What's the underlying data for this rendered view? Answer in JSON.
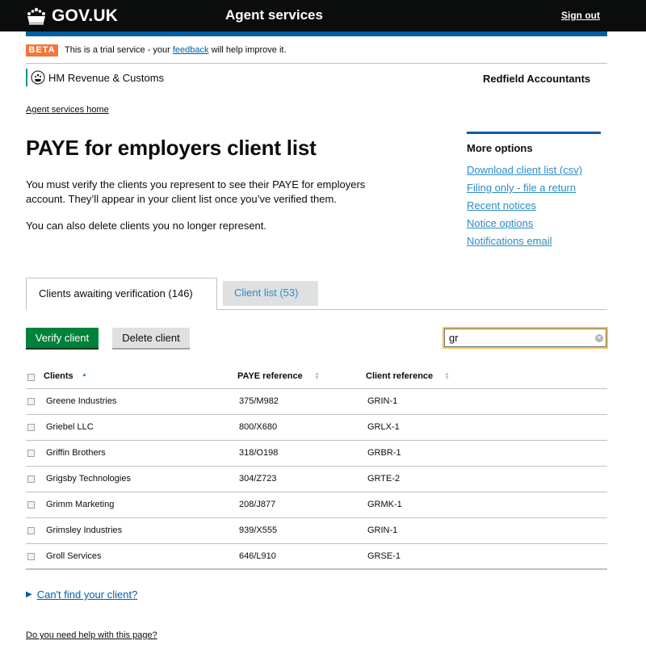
{
  "header": {
    "logo_text": "GOV.UK",
    "service_name": "Agent services",
    "sign_out": "Sign out"
  },
  "beta": {
    "tag": "BETA",
    "text_before": "This is a trial service - your ",
    "link": "feedback",
    "text_after": " will help improve it."
  },
  "department": "HM Revenue & Customs",
  "agent_name": "Redfield Accountants",
  "breadcrumb": "Agent services home",
  "page_title": "PAYE for employers client list",
  "intro": "You must verify the clients you represent to see their PAYE for employers account. They’ll appear in your client list once you’ve verified them.",
  "intro2": "You can also delete clients you no longer represent.",
  "sidebar": {
    "title": "More options",
    "links": [
      "Download client list (csv)",
      "Filing only - file a return",
      "Recent notices",
      "Notice options",
      "Notifications email"
    ]
  },
  "tabs": [
    {
      "label": "Clients awaiting verification (146)",
      "active": true
    },
    {
      "label": "Client list (53)",
      "active": false
    }
  ],
  "buttons": {
    "verify": "Verify client",
    "delete": "Delete client"
  },
  "search": {
    "value": "gr"
  },
  "table": {
    "headers": [
      "Clients",
      "PAYE reference",
      "Client reference"
    ],
    "sort_column": "Clients",
    "sort_direction": "ascending",
    "rows": [
      {
        "client": "Greene Industries",
        "paye": "375/M982",
        "ref": "GRIN-1"
      },
      {
        "client": "Griebel LLC",
        "paye": "800/X680",
        "ref": "GRLX-1"
      },
      {
        "client": "Griffin Brothers",
        "paye": "318/O198",
        "ref": "GRBR-1"
      },
      {
        "client": "Grigsby Technologies",
        "paye": "304/Z723",
        "ref": "GRTE-2"
      },
      {
        "client": "Grimm Marketing",
        "paye": "208/J877",
        "ref": "GRMK-1"
      },
      {
        "client": "Grimsley Industries",
        "paye": "939/X555",
        "ref": "GRIN-1"
      },
      {
        "client": "Groll Services",
        "paye": "646/L910",
        "ref": "GRSE-1"
      }
    ]
  },
  "cant_find": "Can't find your client?",
  "help_link": "Do you need help with this page?",
  "colors": {
    "header": "#0b0c0c",
    "brand_blue": "#005ea5",
    "link_blue": "#2b8cc4",
    "beta_orange": "#f47738",
    "verify_green": "#00823b",
    "focus_yellow": "#ffbf47"
  }
}
